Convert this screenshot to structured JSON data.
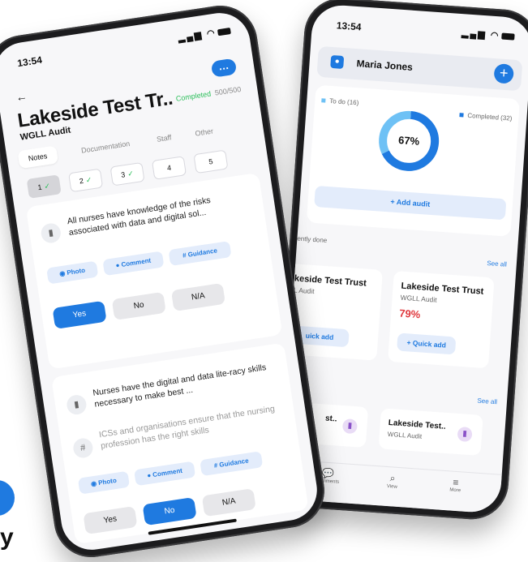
{
  "status": {
    "time": "13:54",
    "icons": "▂▄▆ ◠"
  },
  "right_phone": {
    "user_name": "Maria Jones",
    "add_icon": "+",
    "chart_data": {
      "type": "pie",
      "categories": [
        "To do (16)",
        "Completed (32)"
      ],
      "values": [
        16,
        32
      ],
      "center_label": "67%",
      "colors": [
        "#6ec1f5",
        "#1f7ae0"
      ]
    },
    "add_audit_label": "+ Add audit",
    "recent_label": "ently done",
    "see_all": "See all",
    "recent_cards": [
      {
        "title": "keside Test Trust",
        "sub": "L Audit",
        "pct": "",
        "quick_add": "uick add"
      },
      {
        "title": "Lakeside Test Trust",
        "sub": "WGLL Audit",
        "pct": "79%",
        "quick_add": "+ Quick add"
      }
    ],
    "see_all_2": "See all",
    "bottom_cards": [
      {
        "title": "st..",
        "sub": ""
      },
      {
        "title": "Lakeside Test..",
        "sub": "WGLL Audit"
      }
    ],
    "nav": [
      {
        "icon": "chat-icon",
        "glyph": "💬",
        "label": "Comments"
      },
      {
        "icon": "search-icon",
        "glyph": "⌕",
        "label": "View"
      },
      {
        "icon": "menu-icon",
        "glyph": "≡",
        "label": "More"
      }
    ]
  },
  "left_phone": {
    "back_glyph": "←",
    "more_glyph": "…",
    "title": "Lakeside Test Tr..",
    "completed_label": "Completed",
    "completed_count": "500/500",
    "subtitle": "WGLL Audit",
    "tabs": [
      "Notes",
      "Documentation",
      "Staff",
      "Other"
    ],
    "steps": [
      "1",
      "2",
      "3",
      "4",
      "5"
    ],
    "check": "✓",
    "questions": [
      {
        "text": "All nurses have knowledge of the risks associated with data and digital sol...",
        "photo": "Photo",
        "comment": "Comment",
        "guidance": "Guidance",
        "yes": "Yes",
        "no": "No",
        "na": "N/A",
        "selected": "yes"
      },
      {
        "text": "Nurses have the digital and data lite-racy skills necessary to make best ...",
        "guidance_text": "ICSs and organisations ensure that the nursing profession has the right skills",
        "photo": "Photo",
        "comment": "Comment",
        "guidance": "Guidance",
        "yes": "Yes",
        "no": "No",
        "na": "N/A",
        "selected": "no"
      }
    ]
  },
  "brand": {
    "letter": "y"
  },
  "colors": {
    "accent": "#1f7ae0",
    "success": "#2bbf5a",
    "warn": "#e0393e"
  }
}
